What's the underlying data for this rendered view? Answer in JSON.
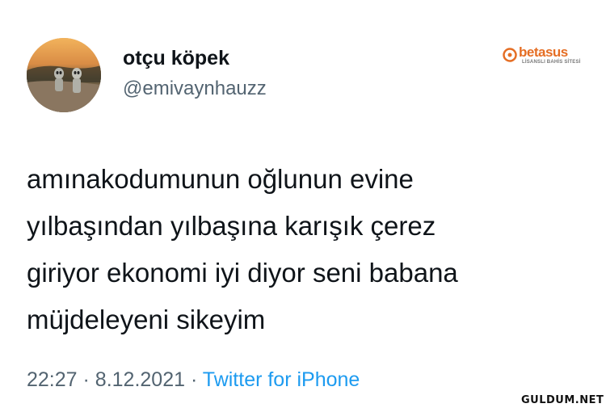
{
  "author": {
    "display_name": "otçu köpek",
    "handle": "@emivaynhauzz"
  },
  "brand": {
    "name": "betasus",
    "tagline": "LİSANSLI BAHİS SİTESİ",
    "accent_color": "#e56e24"
  },
  "tweet": {
    "lines": [
      "amınakodumunun oğlunun evine",
      "yılbaşından yılbaşına karışık çerez",
      "giriyor ekonomi iyi diyor seni babana",
      "müjdeleyeni sikeyim"
    ]
  },
  "meta": {
    "time": "22:27",
    "separator": "·",
    "date": "8.12.2021",
    "source": "Twitter for iPhone",
    "link_color": "#1d9bf0"
  },
  "watermark": {
    "text": "GULDUM.NET"
  }
}
